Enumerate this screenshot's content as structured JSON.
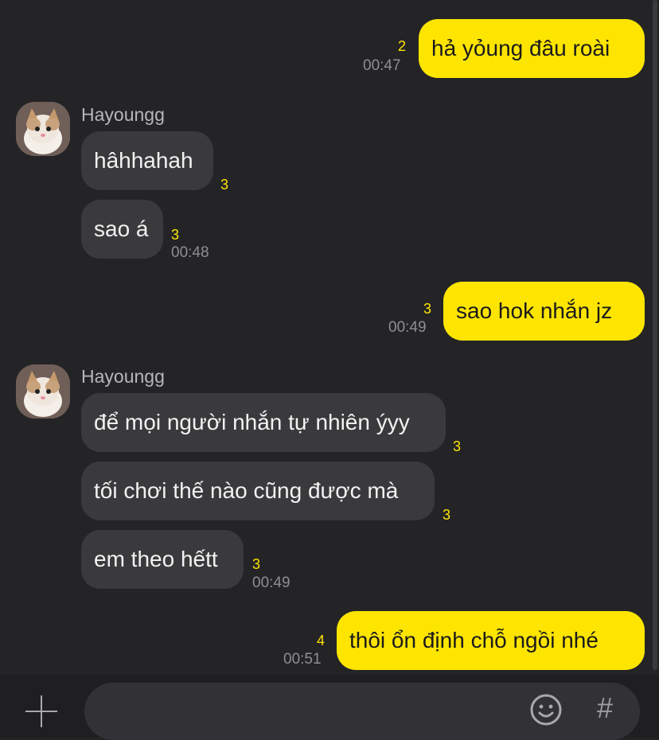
{
  "messages": [
    {
      "side": "out",
      "text": "hả yỏung đâu roài",
      "unread": "2",
      "time": "00:47"
    },
    {
      "side": "in",
      "sender": "Hayoungg",
      "bubbles": [
        {
          "text": "hâhhahah",
          "unread": "3"
        },
        {
          "text": "sao á",
          "unread": "3",
          "time": "00:48"
        }
      ]
    },
    {
      "side": "out",
      "text": "sao hok nhắn jz",
      "unread": "3",
      "time": "00:49"
    },
    {
      "side": "in",
      "sender": "Hayoungg",
      "bubbles": [
        {
          "text": "để mọi người nhắn tự nhiên ýyy",
          "unread": "3"
        },
        {
          "text": "tối chơi thế nào cũng được mà",
          "unread": "3"
        },
        {
          "text": "em theo hếtt",
          "unread": "3",
          "time": "00:49"
        }
      ]
    },
    {
      "side": "out",
      "text": "thôi ổn định chỗ ngồi nhé",
      "unread": "4",
      "time": "00:51"
    }
  ],
  "composer": {
    "placeholder": "",
    "icons": [
      "plus-icon",
      "emoji-icon",
      "hashtag-icon"
    ],
    "hash_symbol": "#"
  },
  "colors": {
    "outgoing": "#fee500",
    "incoming": "#3a3a3d",
    "unread": "#fee500",
    "background": "#242427"
  }
}
